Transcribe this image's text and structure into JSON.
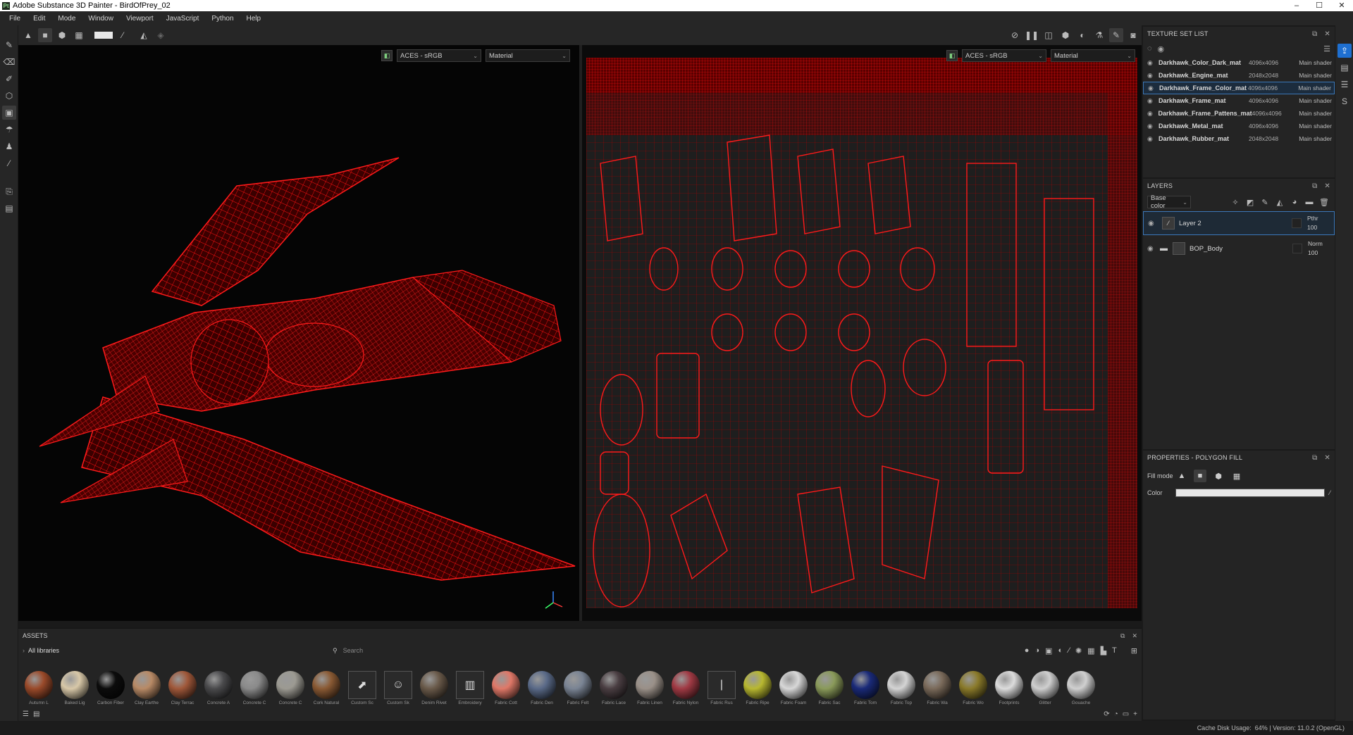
{
  "app": {
    "title": "Adobe Substance 3D Painter - BirdOfPrey_02",
    "logo_letters": "Pt",
    "window_controls": [
      "–",
      "☐",
      "✕"
    ]
  },
  "menu": [
    "File",
    "Edit",
    "Mode",
    "Window",
    "Viewport",
    "JavaScript",
    "Python",
    "Help"
  ],
  "viewport3d": {
    "color_space": "ACES - sRGB",
    "display_mode": "Material",
    "wire_color": "#e00000"
  },
  "viewport2d": {
    "color_space": "ACES - sRGB",
    "display_mode": "Material"
  },
  "texture_set_list": {
    "title": "TEXTURE SET LIST",
    "items": [
      {
        "name": "Darkhawk_Color_Dark_mat",
        "res": "4096x4096",
        "shader": "Main shader"
      },
      {
        "name": "Darkhawk_Engine_mat",
        "res": "2048x2048",
        "shader": "Main shader"
      },
      {
        "name": "Darkhawk_Frame_Color_mat",
        "res": "4096x4096",
        "shader": "Main shader"
      },
      {
        "name": "Darkhawk_Frame_mat",
        "res": "4096x4096",
        "shader": "Main shader"
      },
      {
        "name": "Darkhawk_Frame_Pattens_mat",
        "res": "4096x4096",
        "shader": "Main shader"
      },
      {
        "name": "Darkhawk_Metal_mat",
        "res": "4096x4096",
        "shader": "Main shader"
      },
      {
        "name": "Darkhawk_Rubber_mat",
        "res": "2048x2048",
        "shader": "Main shader"
      }
    ]
  },
  "layers": {
    "title": "LAYERS",
    "channel": "Base color",
    "items": [
      {
        "name": "Layer 2",
        "blend": "Pthr",
        "opacity": "100"
      },
      {
        "name": "BOP_Body",
        "blend": "Norm",
        "opacity": "100"
      }
    ]
  },
  "properties": {
    "title": "PROPERTIES - POLYGON FILL",
    "fill_mode_label": "Fill mode",
    "color_label": "Color",
    "color_value": "#e6e6e6"
  },
  "assets": {
    "title": "ASSETS",
    "library": "All libraries",
    "search_placeholder": "Search",
    "items": [
      {
        "label": "Autumn L",
        "color": "#9a4a2a"
      },
      {
        "label": "Baked Lig",
        "color": "#d8c8a8"
      },
      {
        "label": "Carbon Fiber",
        "color": "#0c0c0c"
      },
      {
        "label": "Clay Earthe",
        "color": "#b88a66"
      },
      {
        "label": "Clay Terrac",
        "color": "#a0583a"
      },
      {
        "label": "Concrete A",
        "color": "#4a4a4c"
      },
      {
        "label": "Concrete C",
        "color": "#8a8a8a"
      },
      {
        "label": "Concrete C",
        "color": "#9c9a92"
      },
      {
        "label": "Cork Natural",
        "color": "#8a5a34"
      },
      {
        "label": "Custom Sc",
        "color": "#2a2a2a"
      },
      {
        "label": "Custom Sk",
        "color": "#2a2a2a"
      },
      {
        "label": "Denim Rivet",
        "color": "#6a5a4a"
      },
      {
        "label": "Embroidery",
        "color": "#2a2a2a"
      },
      {
        "label": "Fabric Cott",
        "color": "#e07868"
      },
      {
        "label": "Fabric Den",
        "color": "#5a6a88"
      },
      {
        "label": "Fabric Felt",
        "color": "#7a8494"
      },
      {
        "label": "Fabric Lace",
        "color": "#4a3e42"
      },
      {
        "label": "Fabric Linen",
        "color": "#9a9088"
      },
      {
        "label": "Fabric Nylon",
        "color": "#a03a44"
      },
      {
        "label": "Fabric Rus",
        "color": "#2a2a2a"
      },
      {
        "label": "Fabric Ripe",
        "color": "#b8b830"
      },
      {
        "label": "Fabric Foam",
        "color": "#d8d8d8"
      },
      {
        "label": "Fabric Sac",
        "color": "#8a9a5a"
      },
      {
        "label": "Fabric Tom",
        "color": "#1a2a78"
      },
      {
        "label": "Fabric Top",
        "color": "#d4d4d4"
      },
      {
        "label": "Fabric Wa",
        "color": "#7a6a5a"
      },
      {
        "label": "Fabric Wo",
        "color": "#8a7a2a"
      },
      {
        "label": "Footprints",
        "color": "#dcdcdc"
      },
      {
        "label": "Glitter",
        "color": "#cfcfcf"
      },
      {
        "label": "Gouache",
        "color": "#d0d0d0"
      }
    ]
  },
  "status": {
    "text": "Cache Disk Usage:",
    "detail": "64% | Version: 11.0.2 (OpenGL)"
  }
}
